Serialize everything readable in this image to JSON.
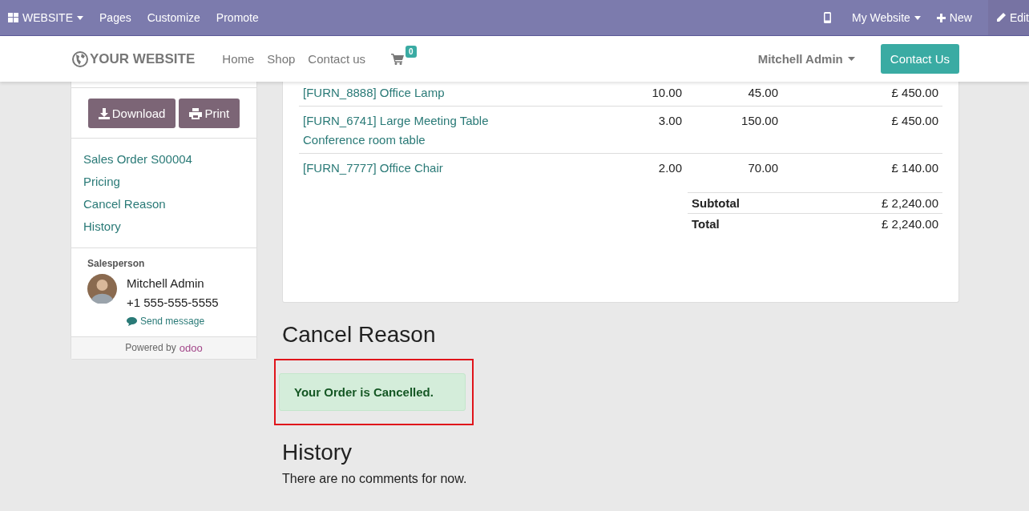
{
  "admin_bar": {
    "app_menu": "WEBSITE",
    "items": [
      "Pages",
      "Customize",
      "Promote"
    ],
    "website_menu": "My Website",
    "new_button": "New",
    "edit_button": "Edit"
  },
  "header": {
    "logo": "YOUR WEBSITE",
    "nav": [
      "Home",
      "Shop",
      "Contact us"
    ],
    "cart_count": "0",
    "user": "Mitchell Admin",
    "cta": "Contact Us"
  },
  "sidebar": {
    "buttons": [
      {
        "kind": "download",
        "label": "Download"
      },
      {
        "kind": "print",
        "label": "Print"
      }
    ],
    "links": [
      "Sales Order S00004",
      "Pricing",
      "Cancel Reason",
      "History"
    ],
    "salesperson_label": "Salesperson",
    "salesperson_name": "Mitchell Admin",
    "salesperson_phone": "+1 555-555-5555",
    "send_message": "Send message",
    "powered_by": "Powered by",
    "powered_brand": "odoo"
  },
  "order_lines": [
    {
      "product": "[FURN_8888] Office Lamp",
      "quantity": "10.00",
      "unit_price": "45.00",
      "amount": "£ 450.00"
    },
    {
      "product": "[FURN_6741] Large Meeting Table",
      "description": "Conference room table",
      "quantity": "3.00",
      "unit_price": "150.00",
      "amount": "£ 450.00"
    },
    {
      "product": "[FURN_7777] Office Chair",
      "quantity": "2.00",
      "unit_price": "70.00",
      "amount": "£ 140.00"
    }
  ],
  "totals": [
    {
      "label": "Subtotal",
      "value": "£ 2,240.00"
    },
    {
      "label": "Total",
      "value": "£ 2,240.00"
    }
  ],
  "cancel_section": {
    "title": "Cancel Reason",
    "message": "Your Order is Cancelled.",
    "highlighted": true
  },
  "history_section": {
    "title": "History",
    "empty_text": "There are no comments for now."
  }
}
